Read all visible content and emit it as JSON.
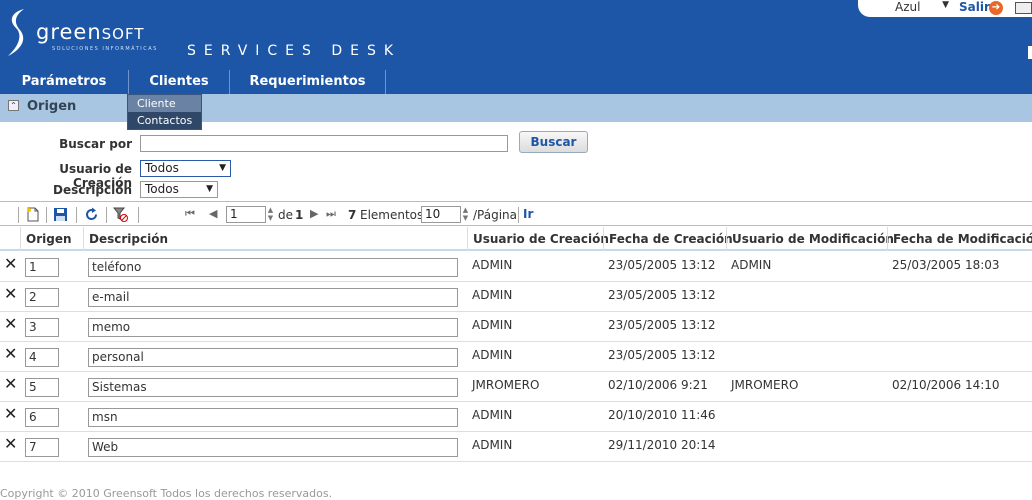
{
  "header": {
    "logo_main": "green",
    "logo_soft": "SOFT",
    "logo_sub": "SOLUCIONES INFORMÁTICAS",
    "app_title": "SERVICES DESK",
    "skin": "Azul",
    "logout_label": "Salir",
    "brand_color": "#1d56a6"
  },
  "menu": {
    "items": [
      {
        "label": "Parámetros"
      },
      {
        "label": "Clientes"
      },
      {
        "label": "Requerimientos"
      }
    ],
    "dropdown": [
      "Cliente",
      "Contactos"
    ]
  },
  "section": {
    "title": "Origen"
  },
  "search": {
    "buscar_por_label": "Buscar por",
    "buscar_por_value": "",
    "buscar_button": "Buscar",
    "usuario_label": "Usuario de Creación",
    "usuario_value": "Todos",
    "descripcion_label": "Descripción",
    "descripcion_value": "Todos"
  },
  "pager": {
    "page": "1",
    "de_label": "de",
    "total_pages": "1",
    "count": "7",
    "elementos_label": "Elementos",
    "page_size": "10",
    "pagina_label": "/Página",
    "ir_label": "Ir"
  },
  "grid": {
    "headers": [
      "Origen",
      "Descripción",
      "Usuario de Creación",
      "Fecha de Creación",
      "Usuario de Modificación",
      "Fecha de Modificación"
    ],
    "rows": [
      {
        "origen": "1",
        "descripcion": "teléfono",
        "usuario_creacion": "ADMIN",
        "fecha_creacion": "23/05/2005 13:12",
        "usuario_mod": "ADMIN",
        "fecha_mod": "25/03/2005 18:03"
      },
      {
        "origen": "2",
        "descripcion": "e-mail",
        "usuario_creacion": "ADMIN",
        "fecha_creacion": "23/05/2005 13:12",
        "usuario_mod": "",
        "fecha_mod": ""
      },
      {
        "origen": "3",
        "descripcion": "memo",
        "usuario_creacion": "ADMIN",
        "fecha_creacion": "23/05/2005 13:12",
        "usuario_mod": "",
        "fecha_mod": ""
      },
      {
        "origen": "4",
        "descripcion": "personal",
        "usuario_creacion": "ADMIN",
        "fecha_creacion": "23/05/2005 13:12",
        "usuario_mod": "",
        "fecha_mod": ""
      },
      {
        "origen": "5",
        "descripcion": "Sistemas",
        "usuario_creacion": "JMROMERO",
        "fecha_creacion": "02/10/2006 9:21",
        "usuario_mod": "JMROMERO",
        "fecha_mod": "02/10/2006 14:10"
      },
      {
        "origen": "6",
        "descripcion": "msn",
        "usuario_creacion": "ADMIN",
        "fecha_creacion": "20/10/2010 11:46",
        "usuario_mod": "",
        "fecha_mod": ""
      },
      {
        "origen": "7",
        "descripcion": "Web",
        "usuario_creacion": "ADMIN",
        "fecha_creacion": "29/11/2010 20:14",
        "usuario_mod": "",
        "fecha_mod": ""
      }
    ]
  },
  "footer": {
    "text": "Copyright © 2010 Greensoft Todos los derechos reservados."
  }
}
